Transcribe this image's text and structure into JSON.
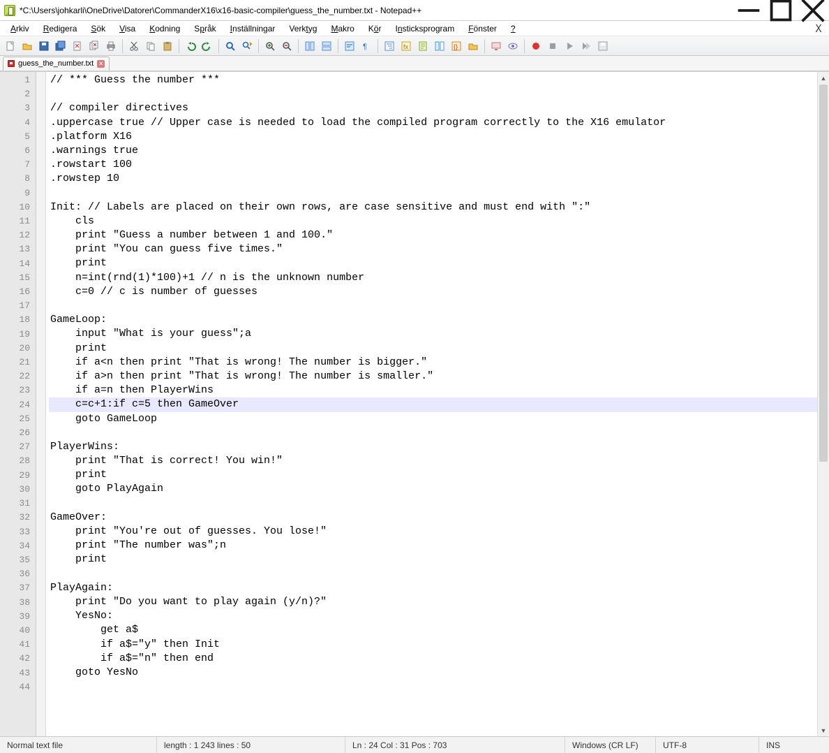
{
  "window": {
    "title": "*C:\\Users\\johkarli\\OneDrive\\Datorer\\CommanderX16\\x16-basic-compiler\\guess_the_number.txt - Notepad++"
  },
  "menu": {
    "items": [
      {
        "pre": "",
        "ul": "A",
        "post": "rkiv"
      },
      {
        "pre": "",
        "ul": "R",
        "post": "edigera"
      },
      {
        "pre": "",
        "ul": "S",
        "post": "ök"
      },
      {
        "pre": "",
        "ul": "V",
        "post": "isa"
      },
      {
        "pre": "",
        "ul": "K",
        "post": "odning"
      },
      {
        "pre": "S",
        "ul": "p",
        "post": "råk"
      },
      {
        "pre": "",
        "ul": "I",
        "post": "nställningar"
      },
      {
        "pre": "Verk",
        "ul": "t",
        "post": "yg"
      },
      {
        "pre": "",
        "ul": "M",
        "post": "akro"
      },
      {
        "pre": "K",
        "ul": "ö",
        "post": "r"
      },
      {
        "pre": "I",
        "ul": "n",
        "post": "sticksprogram"
      },
      {
        "pre": "",
        "ul": "F",
        "post": "önster"
      },
      {
        "pre": "",
        "ul": "?",
        "post": ""
      }
    ],
    "x": "X"
  },
  "tabs": [
    {
      "label": "guess_the_number.txt",
      "modified": true
    }
  ],
  "editor": {
    "current_line_index": 23,
    "lines": [
      "// *** Guess the number ***",
      "",
      "// compiler directives",
      ".uppercase true // Upper case is needed to load the compiled program correctly to the X16 emulator",
      ".platform X16",
      ".warnings true",
      ".rowstart 100",
      ".rowstep 10",
      "",
      "Init: // Labels are placed on their own rows, are case sensitive and must end with \":\"",
      "    cls",
      "    print \"Guess a number between 1 and 100.\"",
      "    print \"You can guess five times.\"",
      "    print",
      "    n=int(rnd(1)*100)+1 // n is the unknown number",
      "    c=0 // c is number of guesses",
      "",
      "GameLoop:",
      "    input \"What is your guess\";a",
      "    print",
      "    if a<n then print \"That is wrong! The number is bigger.\"",
      "    if a>n then print \"That is wrong! The number is smaller.\"",
      "    if a=n then PlayerWins",
      "    c=c+1:if c=5 then GameOver",
      "    goto GameLoop",
      "",
      "PlayerWins:",
      "    print \"That is correct! You win!\"",
      "    print",
      "    goto PlayAgain",
      "",
      "GameOver:",
      "    print \"You're out of guesses. You lose!\"",
      "    print \"The number was\";n",
      "    print",
      "",
      "PlayAgain:",
      "    print \"Do you want to play again (y/n)?\"",
      "    YesNo:",
      "        get a$",
      "        if a$=\"y\" then Init",
      "        if a$=\"n\" then end",
      "    goto YesNo",
      ""
    ]
  },
  "status": {
    "filetype": "Normal text file",
    "length": "length : 1 243    lines : 50",
    "pos": "Ln : 24    Col : 31    Pos : 703",
    "eol": "Windows (CR LF)",
    "enc": "UTF-8",
    "ins": "INS"
  },
  "toolbar_icons": [
    "new-file-icon",
    "open-file-icon",
    "save-icon",
    "save-all-icon",
    "close-icon",
    "close-all-icon",
    "print-icon",
    "sep",
    "cut-icon",
    "copy-icon",
    "paste-icon",
    "sep",
    "undo-icon",
    "redo-icon",
    "sep",
    "find-icon",
    "replace-icon",
    "sep",
    "zoom-in-icon",
    "zoom-out-icon",
    "sep",
    "sync-v-icon",
    "sync-h-icon",
    "sep",
    "wordwrap-icon",
    "show-all-chars-icon",
    "sep",
    "indent-guide-icon",
    "lang-icon",
    "doc-map-icon",
    "doc-list-icon",
    "func-list-icon",
    "folder-icon",
    "sep",
    "monitor-icon",
    "monitor-eye-icon",
    "sep",
    "record-icon",
    "stop-icon",
    "play-icon",
    "play-multi-icon",
    "save-macro-icon"
  ]
}
